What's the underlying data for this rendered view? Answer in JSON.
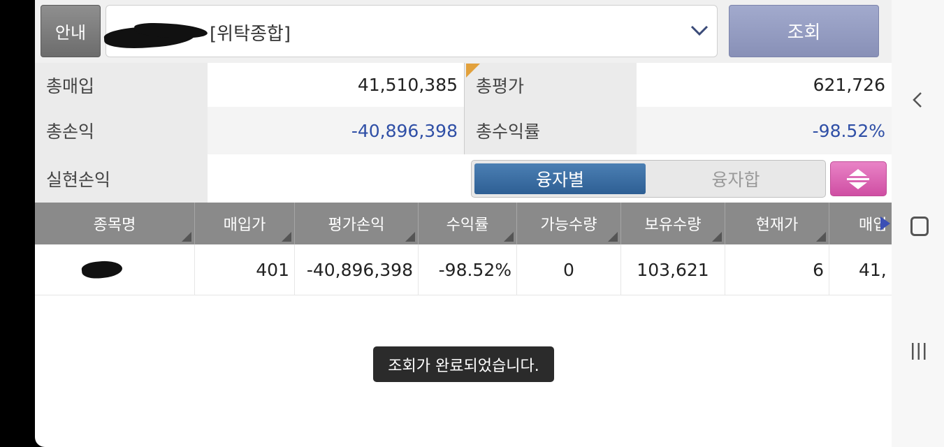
{
  "topbar": {
    "info_label": "안내",
    "account_label": "[위탁종합]",
    "query_label": "조회"
  },
  "summary": {
    "total_purchase_label": "총매입",
    "total_purchase_value": "41,510,385",
    "total_eval_label": "총평가",
    "total_eval_value": "621,726",
    "total_pnl_label": "총손익",
    "total_pnl_value": "-40,896,398",
    "total_return_label": "총수익률",
    "total_return_value": "-98.52%",
    "realized_pnl_label": "실현손익",
    "realized_pnl_value": ""
  },
  "toggle": {
    "by_loan_label": "융자별",
    "loan_sum_label": "융자합"
  },
  "table": {
    "columns": [
      "종목명",
      "매입가",
      "평가손익",
      "수익률",
      "가능수량",
      "보유수량",
      "현재가",
      "매입"
    ],
    "rows": [
      {
        "name": "",
        "buy_price": "401",
        "eval_pnl": "-40,896,398",
        "return_rate": "-98.52%",
        "available_qty": "0",
        "held_qty": "103,621",
        "current_price": "6",
        "buy_amount": "41,"
      }
    ]
  },
  "toast": "조회가 완료되었습니다.",
  "colors": {
    "negative_blue": "#2f4fa6",
    "toggle_active": "#3a6ea5",
    "sort_button": "#dd63b4",
    "query_button": "#959dc3"
  },
  "icons": [
    "chevron-down-icon",
    "sort-updown-icon",
    "scroll-right-arrow-icon",
    "nav-back-icon",
    "nav-home-icon",
    "nav-recents-icon"
  ]
}
